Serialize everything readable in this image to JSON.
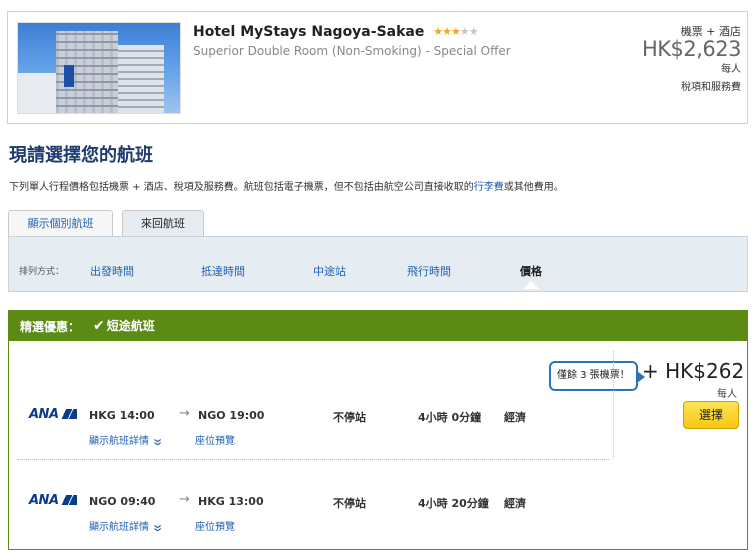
{
  "hotel": {
    "name": "Hotel MyStays Nagoya-Sakae",
    "star_rating": 3,
    "star_max": 5,
    "room": "Superior Double Room (Non-Smoking) - Special Offer",
    "package_label": "機票 + 酒店",
    "price": "HK$2,623",
    "per_person": "每人",
    "tax_note": "稅項和服務費"
  },
  "heading": {
    "title": "現請選擇您的航班",
    "desc_before": "下列單人行程價格包括機票 + 酒店、稅項及服務費。航班包括電子機票，但不包括由航空公司直接收取的",
    "desc_link": "行李費",
    "desc_after": "或其他費用。"
  },
  "tabs": {
    "individual": "顯示個別航班",
    "round_trip": "來回航班"
  },
  "sort": {
    "label": "排列方式：",
    "items": [
      "出發時間",
      "抵達時間",
      "中途站",
      "飛行時間",
      "價格"
    ],
    "active_index": 4
  },
  "results": {
    "header_label": "精選優惠：",
    "header_tag": "短途航班",
    "seats_left": "僅餘 3 張機票！",
    "price": "+ HK$262",
    "per_person": "每人",
    "select_label": "選擇",
    "segments": [
      {
        "airline": "ANA",
        "depart": "HKG 14:00",
        "arrive": "NGO 19:00",
        "stops": "不停站",
        "duration": "4小時 0分鐘",
        "cabin": "經濟",
        "details_link": "顯示航班詳情",
        "seat_link": "座位預覽"
      },
      {
        "airline": "ANA",
        "depart": "NGO 09:40",
        "arrive": "HKG 13:00",
        "stops": "不停站",
        "duration": "4小時 20分鐘",
        "cabin": "經濟",
        "details_link": "顯示航班詳情",
        "seat_link": "座位預覽"
      }
    ]
  },
  "colors": {
    "brand_dark": "#1f3b6f",
    "link": "#2361b0",
    "deal_green": "#5b8a15",
    "button_yellow": "#f7c911",
    "star": "#f0a81c"
  },
  "icons": [
    "star-icon",
    "checkmark-icon",
    "arrow-right-icon",
    "double-chevron-down-icon",
    "ana-logo-icon",
    "sort-caret-icon"
  ]
}
